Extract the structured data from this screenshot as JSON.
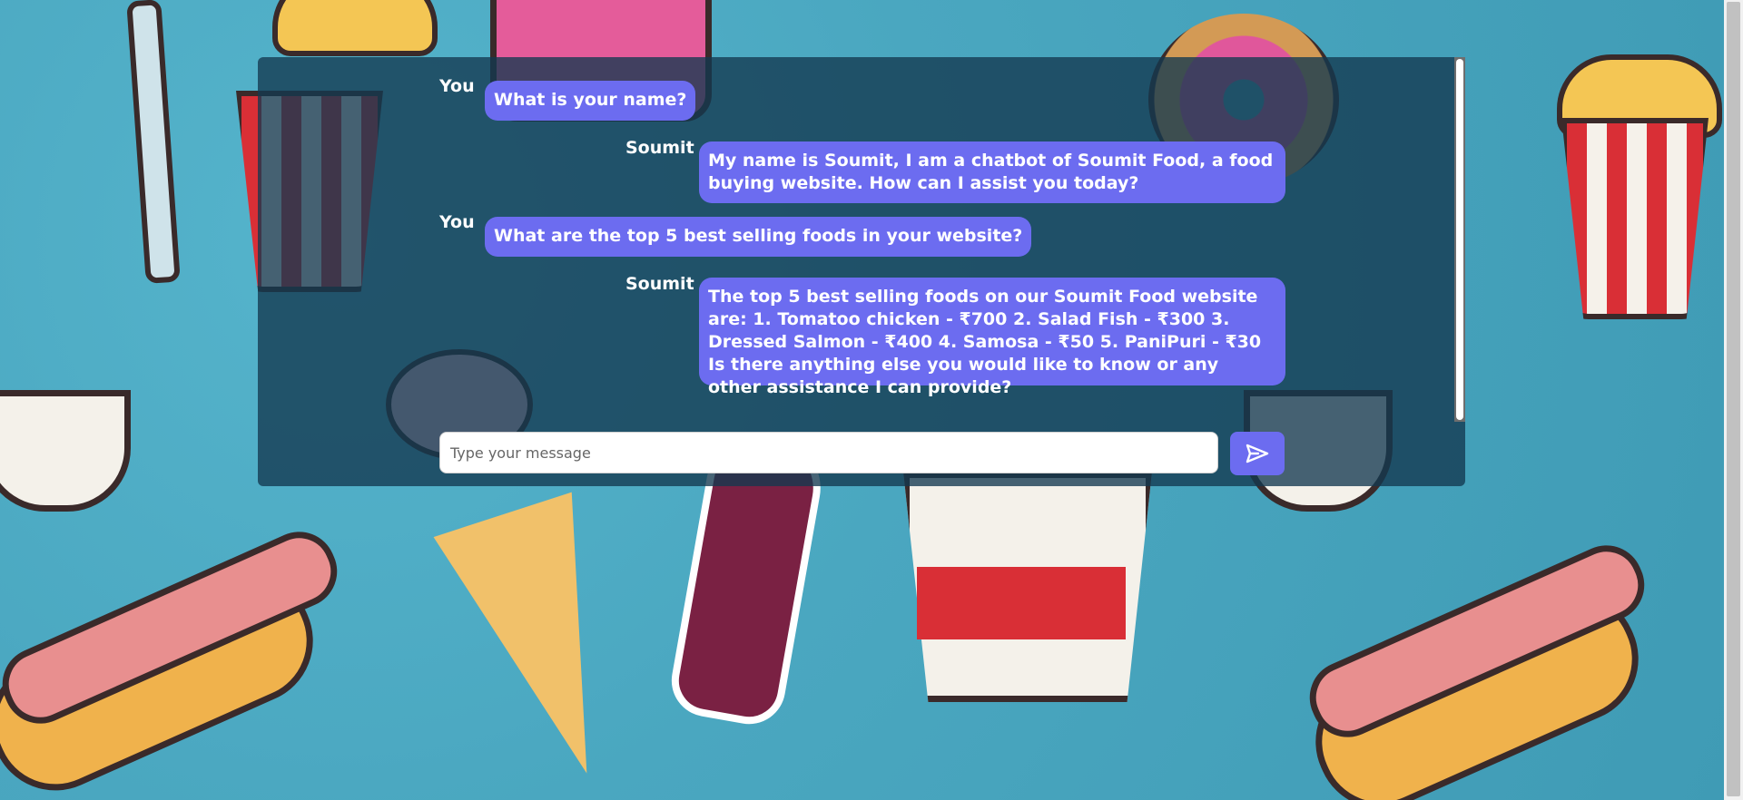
{
  "chat": {
    "messages": [
      {
        "sender": "You",
        "text": "What is your name?"
      },
      {
        "sender": "Soumit",
        "text": "My name is Soumit, I am a chatbot of Soumit Food, a food buying website. How can I assist you today?"
      },
      {
        "sender": "You",
        "text": "What are the top 5 best selling foods in your website?"
      },
      {
        "sender": "Soumit",
        "text": "The top 5 best selling foods on our Soumit Food website are: 1. Tomatoo chicken - ₹700 2. Salad Fish - ₹300 3. Dressed Salmon - ₹400 4. Samosa - ₹50 5. PaniPuri - ₹30 Is there anything else you would like to know or any other assistance I can provide?"
      }
    ]
  },
  "input": {
    "placeholder": "Type your message",
    "value": ""
  },
  "send_button": {
    "icon": "send-icon"
  },
  "colors": {
    "bubble": "#6c6cf0",
    "panel": "#133850",
    "background": "#4aa7c0"
  }
}
